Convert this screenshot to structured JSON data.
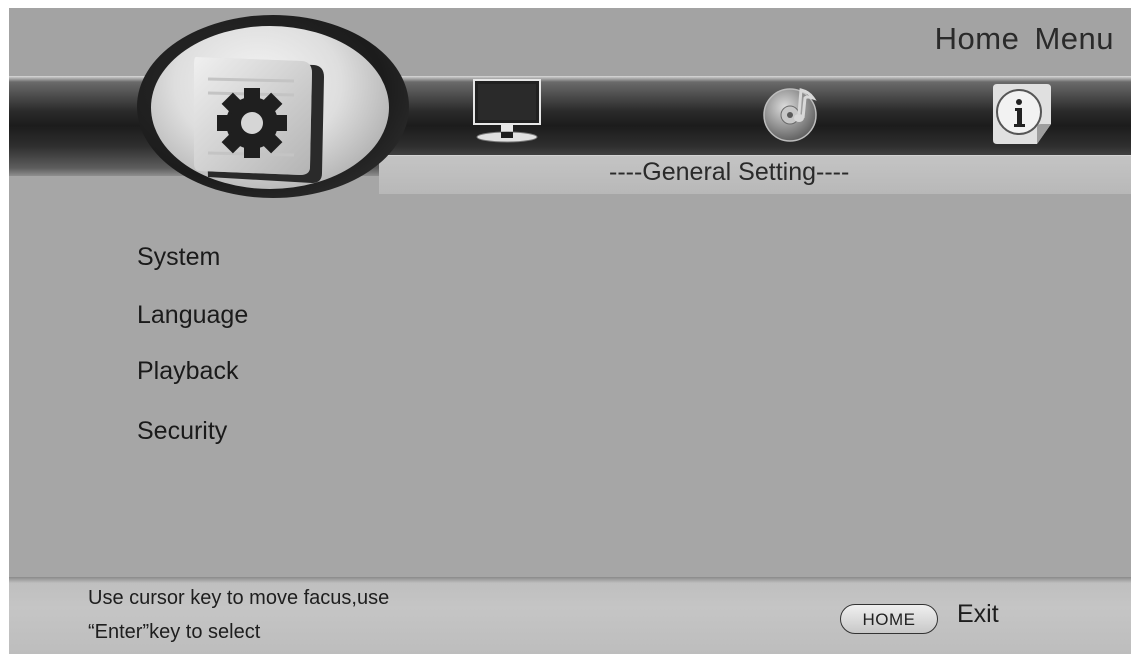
{
  "header": {
    "title": "Home  Menu",
    "section": "----General Setting----"
  },
  "nav": {
    "icons": [
      {
        "name": "general-setting-icon",
        "selected": true
      },
      {
        "name": "monitor-icon",
        "selected": false
      },
      {
        "name": "music-disc-icon",
        "selected": false
      },
      {
        "name": "info-icon",
        "selected": false
      }
    ]
  },
  "menu": {
    "items": [
      {
        "label": "System"
      },
      {
        "label": "Language"
      },
      {
        "label": "Playback"
      },
      {
        "label": "Security"
      }
    ]
  },
  "footer": {
    "hint_line1": "Use cursor key to move facus,use",
    "hint_line2": "“Enter”key to select",
    "home_key": "HOME",
    "exit_label": "Exit"
  },
  "colors": {
    "background": "#a6a6a6",
    "band": "#1c1c1c",
    "text": "#1a1a1a"
  }
}
